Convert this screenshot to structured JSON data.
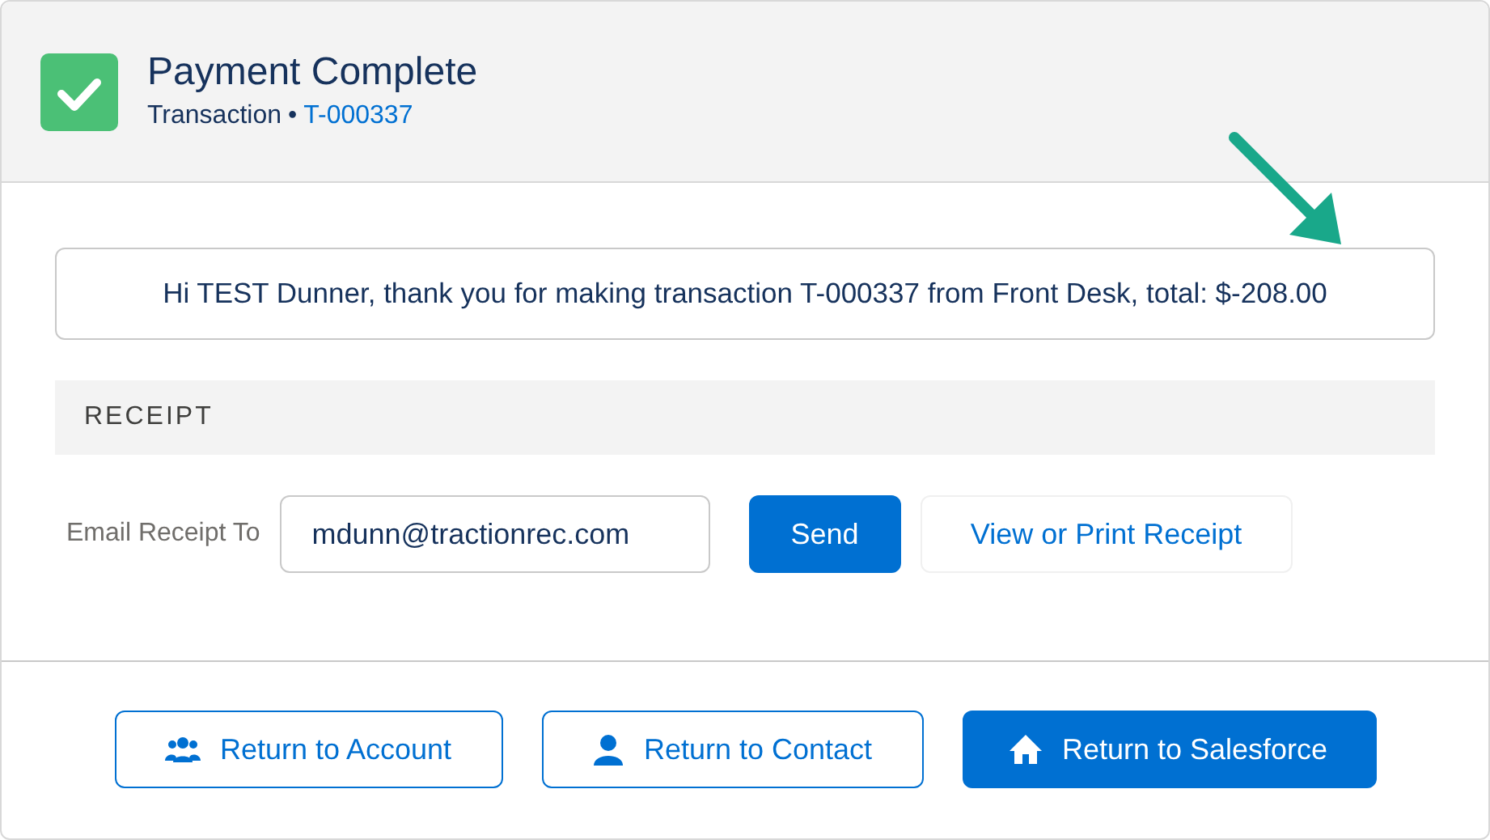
{
  "header": {
    "title": "Payment Complete",
    "subtitle": "Transaction",
    "separator": "•",
    "link": "T-000337"
  },
  "message": "Hi TEST Dunner, thank you for making transaction T-000337 from Front Desk, total: $-208.00",
  "receipt": {
    "heading": "RECEIPT",
    "email_label": "Email Receipt To",
    "email_value": "mdunn@tractionrec.com",
    "send_button": "Send",
    "view_button": "View or Print Receipt"
  },
  "footer_buttons": [
    {
      "label": "Return to Account",
      "kind": "account"
    },
    {
      "label": "Return to Contact",
      "kind": "contact"
    },
    {
      "label": "Return to Salesforce",
      "kind": "home"
    }
  ]
}
